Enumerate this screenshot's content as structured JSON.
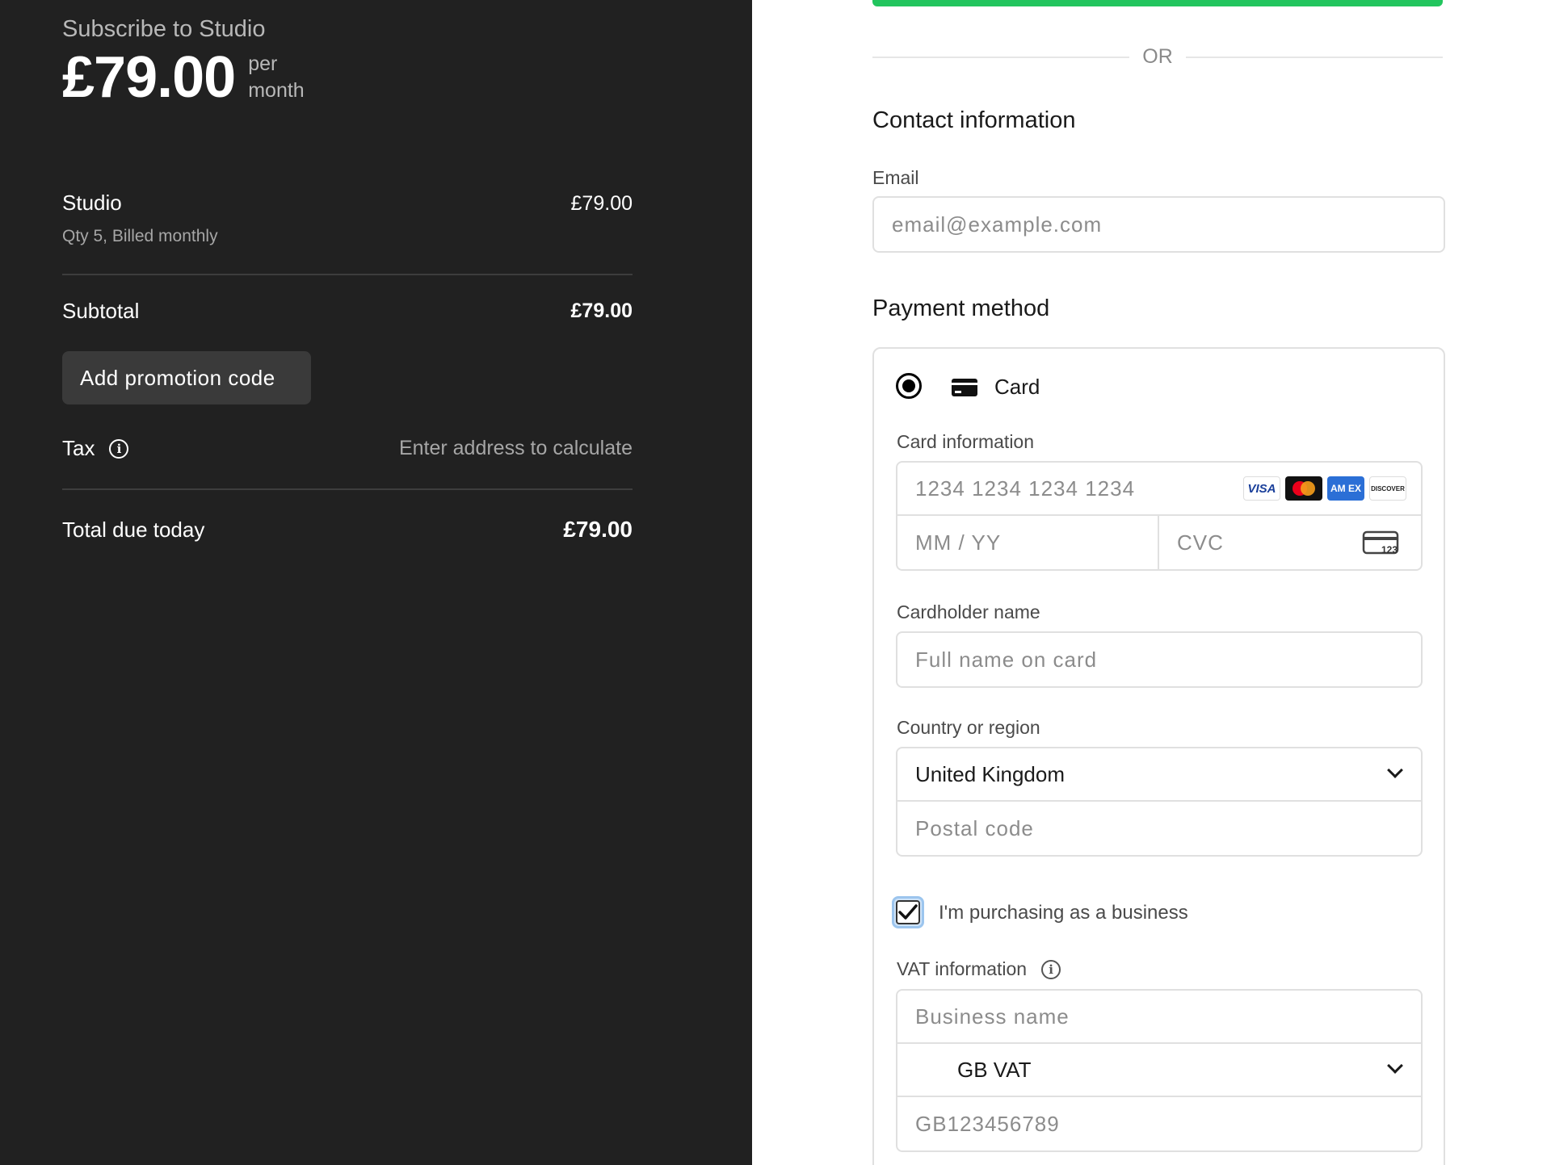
{
  "summary": {
    "title": "Subscribe to Studio",
    "price": "£79.00",
    "price_unit_1": "per",
    "price_unit_2": "month",
    "item_name": "Studio",
    "item_meta": "Qty 5, Billed monthly",
    "item_amount": "£79.00",
    "subtotal_label": "Subtotal",
    "subtotal_value": "£79.00",
    "promo_button": "Add promotion code",
    "tax_label": "Tax",
    "tax_value": "Enter address to calculate",
    "total_label": "Total due today",
    "total_value": "£79.00"
  },
  "form": {
    "or_text": "OR",
    "contact_title": "Contact information",
    "email_label": "Email",
    "email_placeholder": "email@example.com",
    "payment_title": "Payment method",
    "card_option": "Card",
    "card_info_label": "Card information",
    "card_number_placeholder": "1234 1234 1234 1234",
    "expiry_placeholder": "MM / YY",
    "cvc_placeholder": "CVC",
    "cvc_icon_text": "123",
    "cardholder_label": "Cardholder name",
    "cardholder_placeholder": "Full name on card",
    "country_label": "Country or region",
    "country_value": "United Kingdom",
    "postal_placeholder": "Postal code",
    "business_checkbox_label": "I'm purchasing as a business",
    "business_checkbox_checked": true,
    "vat_label": "VAT information",
    "business_name_placeholder": "Business name",
    "vat_type_value": "GB VAT",
    "vat_number_placeholder": "GB123456789"
  },
  "brands": {
    "visa": "VISA",
    "amex": "AM EX",
    "discover": "DISCOVER"
  },
  "colors": {
    "left_panel_bg": "#212121",
    "accent_green": "#22c55e",
    "checkbox_highlight": "#cfe3f7"
  }
}
